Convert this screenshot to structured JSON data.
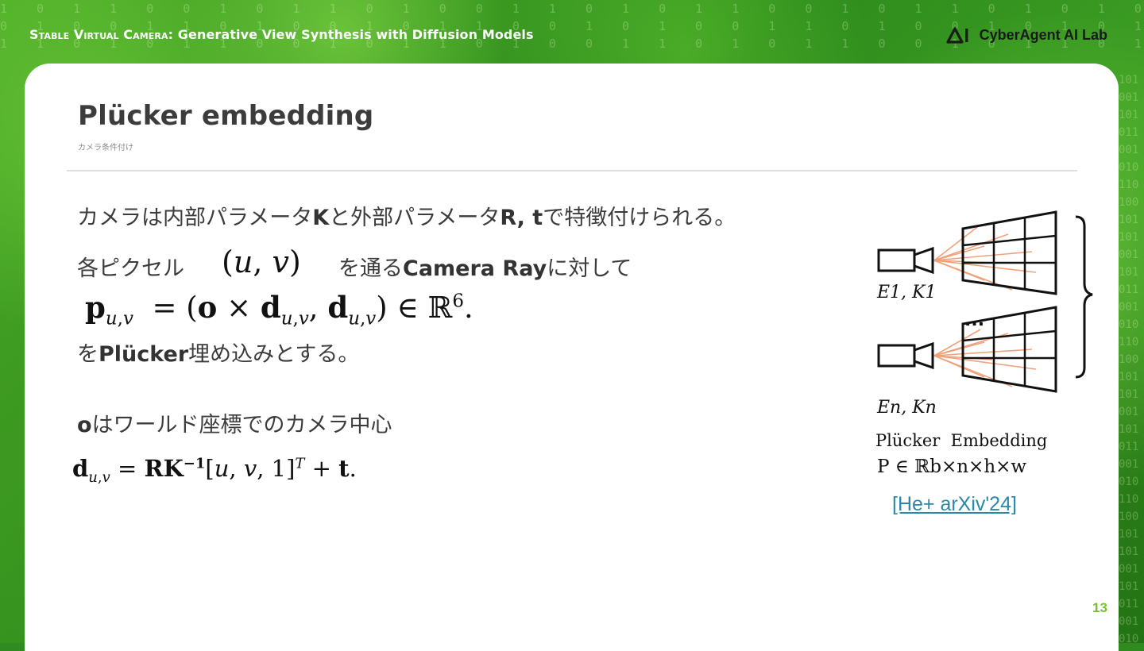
{
  "header": {
    "title_sc": "Stable Virtual Camera",
    "title_rest": ": Generative View Synthesis with Diffusion Models",
    "logo_text": "CyberAgent AI Lab"
  },
  "slide": {
    "title": "Plücker embedding",
    "subtitle": "カメラ条件付け",
    "line1": {
      "a": "カメラは内部パラメータ",
      "b": "K",
      "c": "と外部パラメータ",
      "d": "R, t",
      "e": "で特徴付けられる。"
    },
    "line2": {
      "a": "各ピクセル",
      "b": "を通る",
      "c": "Camera Ray",
      "d": "に対して"
    },
    "line3": {
      "a": "を",
      "b": "Plücker",
      "c": "埋め込みとする。"
    },
    "line4": {
      "a": "o",
      "b": "はワールド座標でのカメラ中心"
    },
    "citation": "[He+ arXiv'24]",
    "page_number": "13"
  },
  "figure": {
    "label_top": "E1, K1",
    "label_bottom": "En, Kn",
    "ellipsis": "...",
    "caption": "Plücker  Embedding",
    "formula": "P ∈ ℝb×n×h×w"
  },
  "colors": {
    "accent_green": "#7bbf2a",
    "link": "#2a88a8",
    "ray": "#f0a27a"
  }
}
